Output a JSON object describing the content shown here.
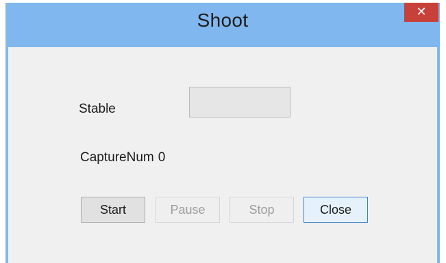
{
  "window": {
    "title": "Shoot",
    "close_glyph": "✕",
    "close_icon": "close-icon"
  },
  "form": {
    "stable_label": "Stable",
    "stable_value": "",
    "capture_label": "CaptureNum",
    "capture_value": "0"
  },
  "buttons": {
    "start": "Start",
    "pause": "Pause",
    "stop": "Stop",
    "close": "Close"
  },
  "colors": {
    "titlebar": "#7fb7ee",
    "close_button": "#c7413a",
    "client_bg": "#f0f0f0",
    "default_button_border": "#3c7fc8"
  }
}
